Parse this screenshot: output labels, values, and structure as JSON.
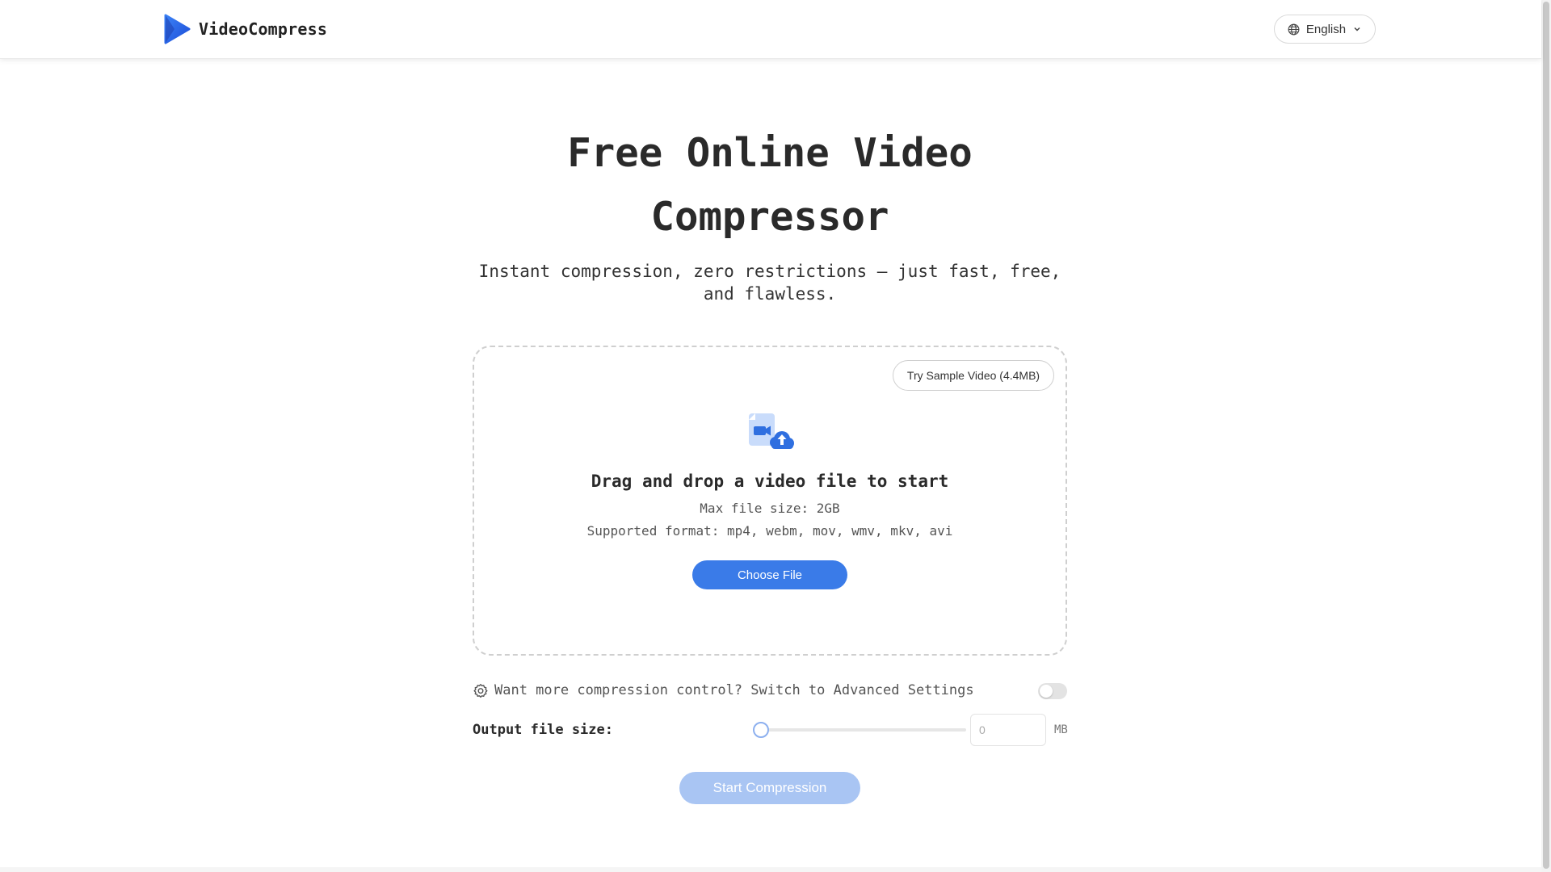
{
  "header": {
    "brand_name": "VideoCompress",
    "language_label": "English"
  },
  "hero": {
    "title": "Free Online Video Compressor",
    "subtitle": "Instant compression, zero restrictions — just fast, free, and flawless."
  },
  "dropzone": {
    "sample_button_label": "Try Sample Video (4.4MB)",
    "title": "Drag and drop a video file to start",
    "max_size_text": "Max file size: 2GB",
    "formats_text": "Supported format: mp4, webm, mov, wmv, mkv, avi",
    "choose_button_label": "Choose File"
  },
  "advanced": {
    "text": "Want more compression control? Switch to Advanced Settings",
    "enabled": false
  },
  "output": {
    "label": "Output file size:",
    "slider_value": 0,
    "input_value": "",
    "input_placeholder": "0",
    "unit": "MB"
  },
  "actions": {
    "start_button_label": "Start Compression"
  },
  "colors": {
    "brand_blue": "#2563eb",
    "primary_button": "#3a7be8",
    "disabled_button": "#a9c5f3"
  }
}
